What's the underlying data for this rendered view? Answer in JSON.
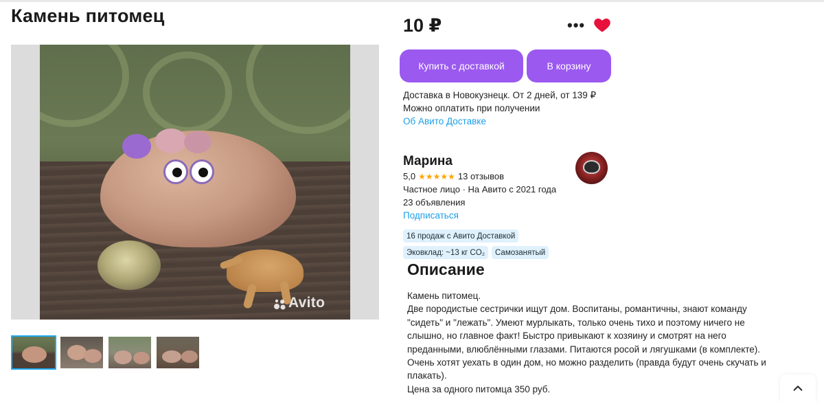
{
  "listing": {
    "title": "Камень питомец",
    "price": "10 ₽"
  },
  "actions": {
    "more_label": "•••",
    "buy_with_delivery": "Купить с доставкой",
    "add_to_cart": "В корзину"
  },
  "delivery": {
    "line1": "Доставка в Новокузнецк. От 2 дней, от 139 ₽",
    "line2": "Можно оплатить при получении",
    "link": "Об Авито Доставке"
  },
  "seller": {
    "name": "Марина",
    "rating": "5,0",
    "stars": "★★★★★",
    "reviews": "13 отзывов",
    "type": "Частное лицо · На Авито с 2021 года",
    "listings": "23 объявления",
    "subscribe": "Подписаться",
    "badges": [
      "16 продаж с Авито Доставкой",
      "Эковклад: ~13 кг CO₂",
      "Самозанятый"
    ]
  },
  "description": {
    "heading": "Описание",
    "paragraphs": [
      "Камень питомец.",
      "Две породистые сестрички ищут дом. Воспитаны, романтичны, знают команду \"сидеть\" и \"лежать\". Умеют мурлыкать, только очень тихо и поэтому ничего не слышно, но главное факт! Быстро привыкают к хозяину и смотрят на него преданными, влюблёнными глазами. Питаются росой и лягушками (в комплекте). Очень хотят уехать в один дом, но можно разделить (правда будут очень скучать и плакать).",
      "Цена за одного питомца 350 руб."
    ]
  },
  "gallery": {
    "watermark": "Avito",
    "thumbnail_count": 4,
    "active_thumbnail": 1
  },
  "colors": {
    "primary_button": "#9b59f0",
    "link": "#1a9ee8",
    "heart": "#e8113c",
    "star": "#ffa500",
    "badge_bg": "#dff1fc",
    "active_thumb_border": "#1fa9f2"
  },
  "icons": {
    "more": "more-horizontal-icon",
    "favorite": "heart-icon",
    "scroll_top": "chevron-up-icon"
  }
}
